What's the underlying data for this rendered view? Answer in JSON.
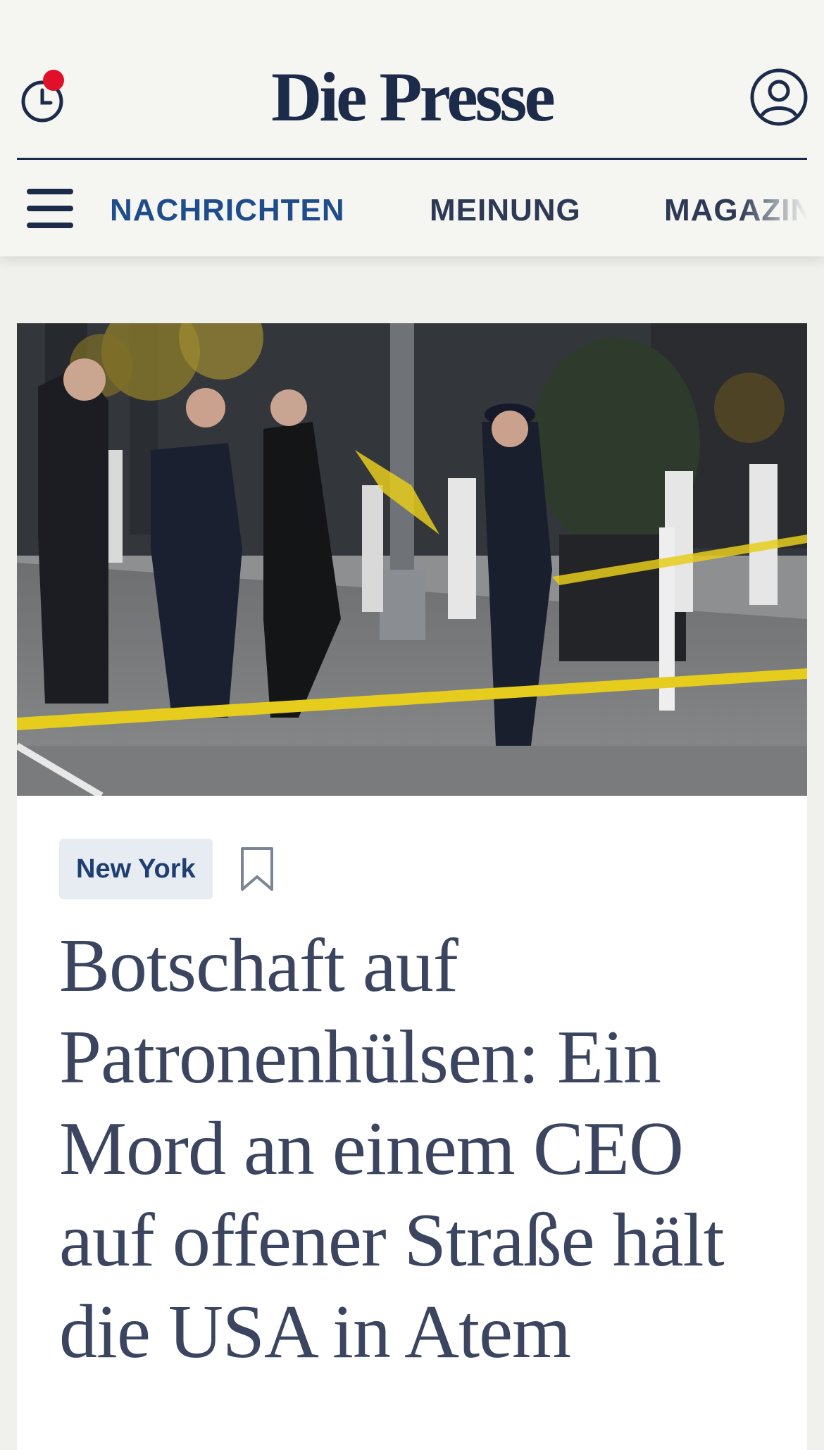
{
  "header": {
    "logo": "Die Presse",
    "history_icon": "clock-icon",
    "history_notification": true,
    "account_icon": "user-icon"
  },
  "nav": {
    "menu_icon": "hamburger-icon",
    "items": [
      {
        "label": "NACHRICHTEN",
        "active": true
      },
      {
        "label": "MEINUNG",
        "active": false
      },
      {
        "label": "MAGAZIN",
        "active": false
      }
    ]
  },
  "article": {
    "image_alt": "Polizisten an einem abgesperrten Tatort in New York",
    "tag": "New York",
    "bookmark_icon": "bookmark-icon",
    "headline": "Botschaft auf Patronenhülsen: Ein Mord an einem CEO auf offener Straße hält die USA in Atem"
  },
  "colors": {
    "brand": "#1d2b4a",
    "nav_active": "#1f4d8c",
    "notification": "#e0102a",
    "headline": "#3b4560",
    "tag_bg": "#e7ebf2",
    "page_bg": "#f0f0ec"
  }
}
